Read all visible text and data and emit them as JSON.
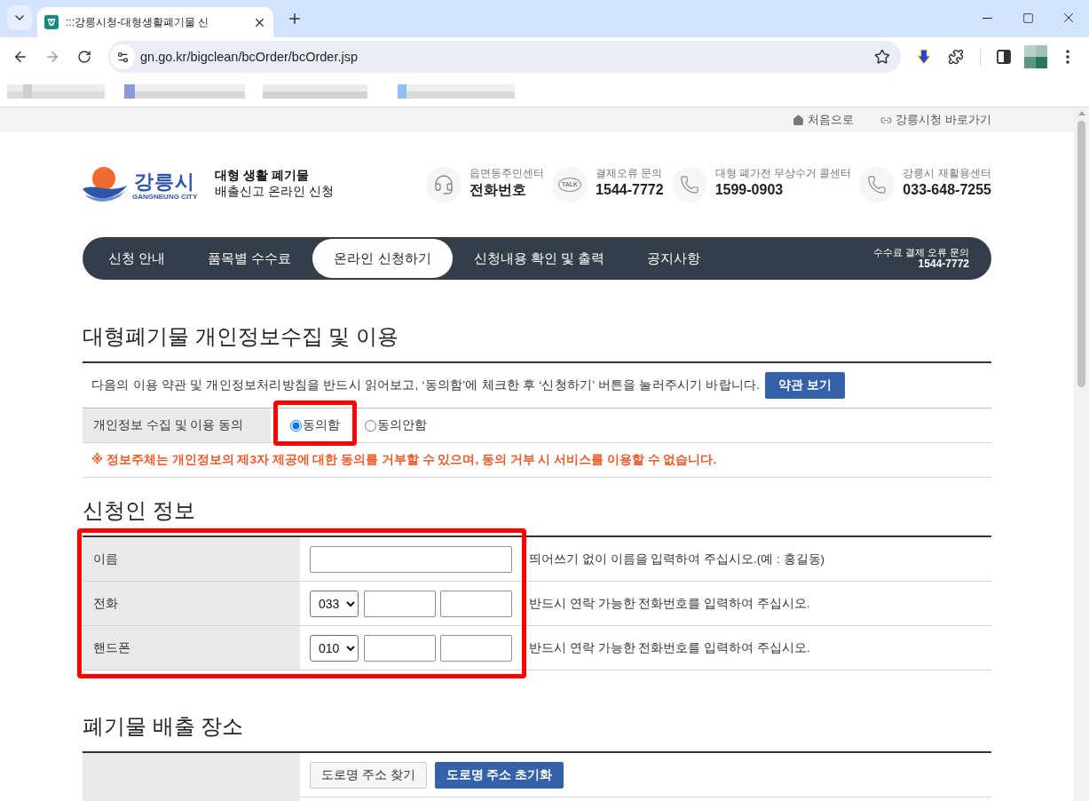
{
  "browser": {
    "tab_title": ":::강릉시청-대형생활폐기물 신",
    "url": "gn.go.kr/bigclean/bcOrder/bcOrder.jsp"
  },
  "util_links": [
    {
      "kind": "home",
      "label": "처음으로"
    },
    {
      "kind": "link",
      "label": "강릉시청 바로가기"
    }
  ],
  "header": {
    "logo": {
      "name": "강릉시",
      "subtitle": "GANGNEUNG CITY"
    },
    "title": "대형 생활 폐기물",
    "subtitle": "배출신고 온라인 신청",
    "contacts": [
      {
        "kind": "headset",
        "label": "읍면동주민센터",
        "value": "전화번호"
      },
      {
        "kind": "talk",
        "badge": "TALK",
        "label": "결제오류 문의",
        "value": "1544-7772"
      },
      {
        "kind": "phone",
        "label": "대형 폐가전 무상수거 콜센터",
        "value": "1599-0903"
      },
      {
        "kind": "phone",
        "label": "강릉시 재활용센터",
        "value": "033-648-7255"
      }
    ]
  },
  "nav": {
    "items": [
      {
        "label": "신청 안내",
        "selected": false
      },
      {
        "label": "품목별 수수료",
        "selected": false
      },
      {
        "label": "온라인 신청하기",
        "selected": true
      },
      {
        "label": "신청내용 확인 및 출력",
        "selected": false
      },
      {
        "label": "공지사항",
        "selected": false
      }
    ],
    "help": {
      "label": "수수료 결제 오류 문의",
      "number": "1544-7772"
    }
  },
  "consent_section": {
    "title": "대형폐기물 개인정보수집 및 이용",
    "intro": "다음의 이용 약관 및 개인정보처리방침을 반드시 읽어보고, ‘동의함’에 체크한 후 ‘신청하기’ 버튼을 눌러주시기 바랍니다.",
    "terms_button": "약관 보기",
    "row_label": "개인정보 수집 및 이용 동의",
    "options": [
      {
        "label": "동의함",
        "selected": true,
        "highlighted": true
      },
      {
        "label": "동의안함",
        "selected": false,
        "highlighted": false
      }
    ],
    "warning": "※ 정보주체는 개인정보의 제3자 제공에 대한 동의를 거부할 수 있으며, 동의 거부 시 서비스를 이용할 수 없습니다."
  },
  "applicant_section": {
    "title": "신청인 정보",
    "highlighted": true,
    "rows": [
      {
        "kind": "text",
        "label": "이름",
        "hint": "띄어쓰기 없이 이름을 입력하여 주십시오.(예 : 홍길동)"
      },
      {
        "kind": "phone",
        "label": "전화",
        "prefix": "033",
        "hint": "반드시 연락 가능한 전화번호를 입력하여 주십시오."
      },
      {
        "kind": "phone",
        "label": "핸드폰",
        "prefix": "010",
        "hint": "반드시 연락 가능한 전화번호를 입력하여 주십시오."
      }
    ]
  },
  "location_section": {
    "title": "폐기물 배출 장소",
    "buttons": [
      {
        "label": "도로명 주소 찾기",
        "primary": false
      },
      {
        "label": "도로명 주소 초기화",
        "primary": true
      }
    ]
  }
}
